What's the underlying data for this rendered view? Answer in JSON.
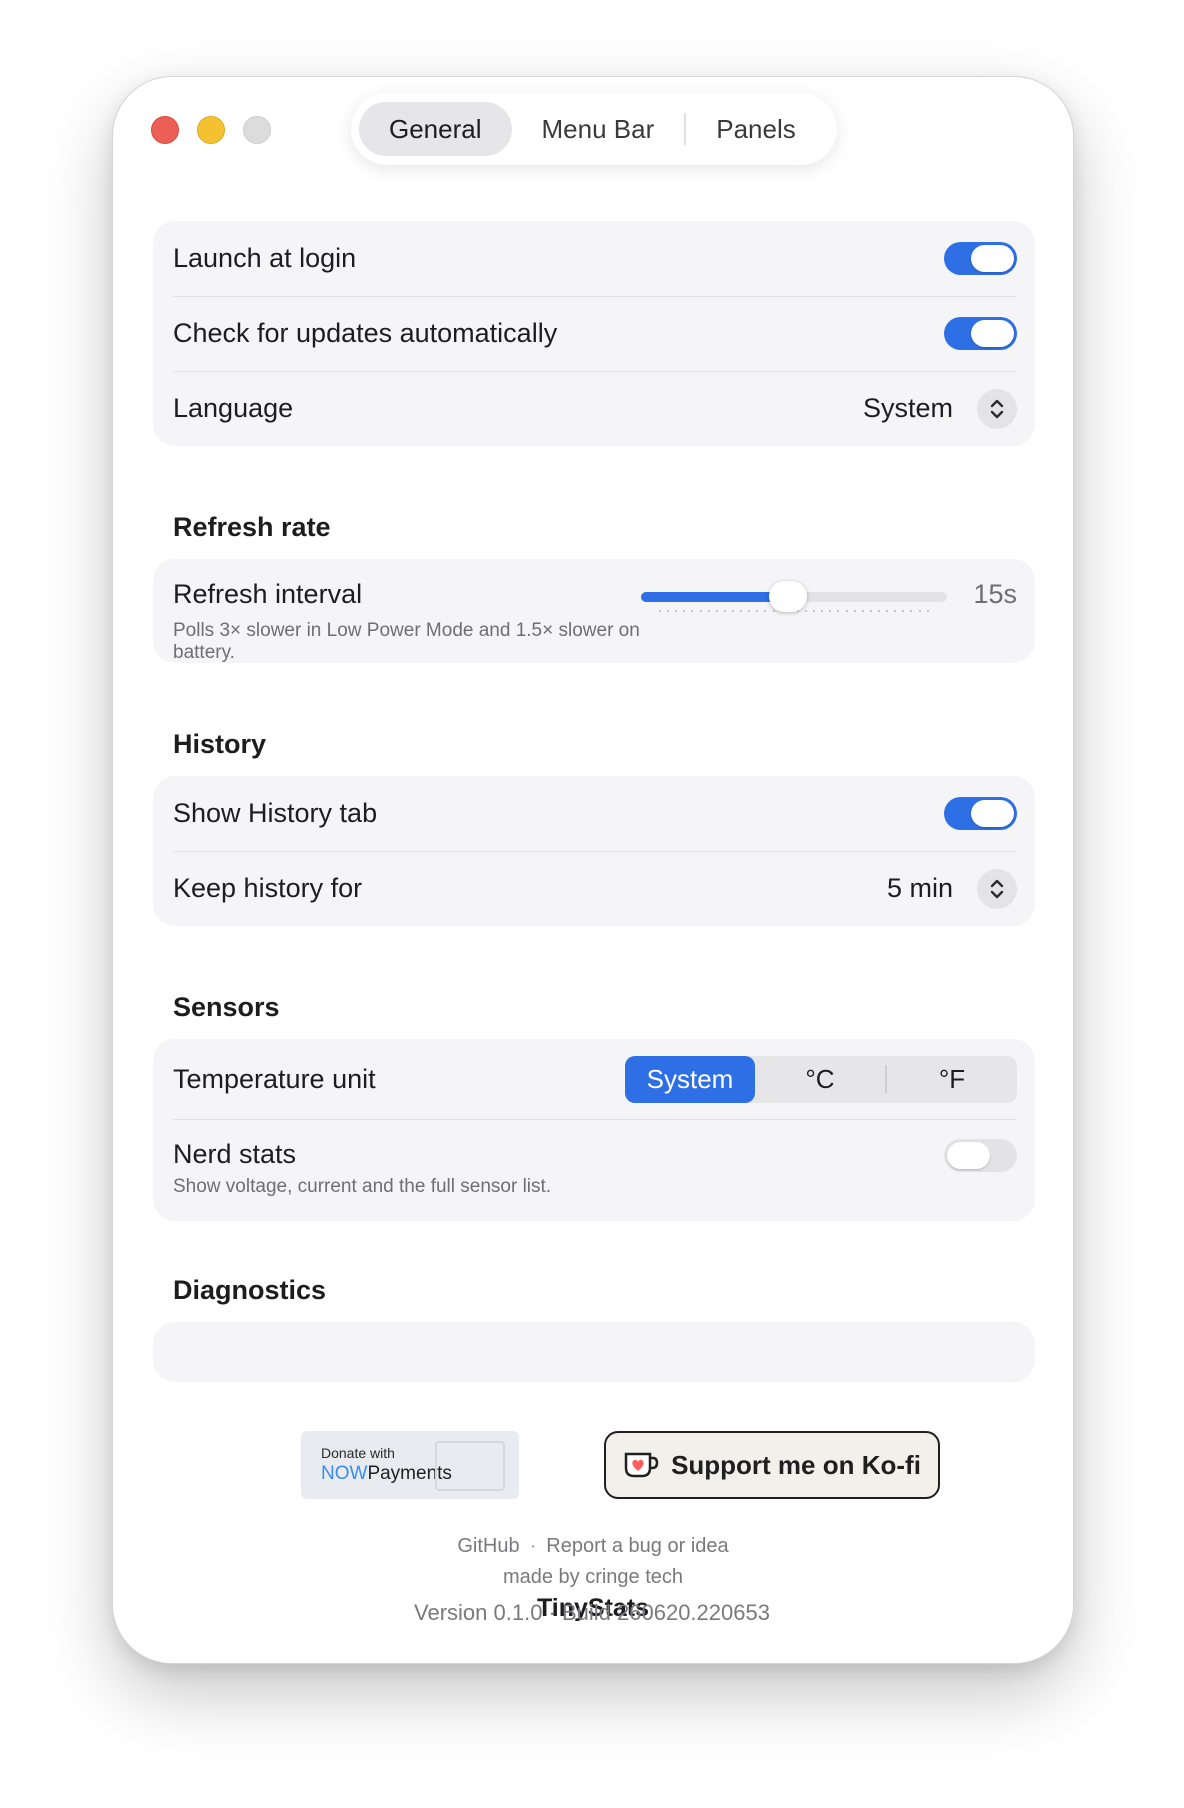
{
  "window": {
    "tabs": [
      {
        "label": "General",
        "active": true
      },
      {
        "label": "Menu Bar",
        "active": false
      },
      {
        "label": "Panels",
        "active": false
      }
    ]
  },
  "general": {
    "launch_at_login": {
      "label": "Launch at login",
      "on": true
    },
    "check_updates": {
      "label": "Check for updates automatically",
      "on": true
    },
    "language": {
      "label": "Language",
      "value": "System"
    }
  },
  "refresh": {
    "title": "Refresh rate",
    "interval_label": "Refresh interval",
    "interval_value": "15s",
    "interval_fraction": 0.48,
    "note": "Polls 3× slower in Low Power Mode and 1.5× slower on battery."
  },
  "history": {
    "title": "History",
    "show_tab": {
      "label": "Show History tab",
      "on": true
    },
    "keep_for": {
      "label": "Keep history for",
      "value": "5 min"
    }
  },
  "sensors": {
    "title": "Sensors",
    "temperature_unit": {
      "label": "Temperature unit",
      "options": [
        "System",
        "°C",
        "°F"
      ],
      "selected": "System"
    },
    "nerd_stats": {
      "label": "Nerd stats",
      "note": "Show voltage, current and the full sensor list.",
      "on": false
    }
  },
  "diagnostics": {
    "title": "Diagnostics"
  },
  "footer": {
    "nowpayments": {
      "line1": "Donate with",
      "brand_now": "NOW",
      "brand_rest": "Payments"
    },
    "kofi_label": "Support me on Ko-fi",
    "github_link": "GitHub",
    "separator": "·",
    "report_link": "Report a bug or idea",
    "made_by": "made by cringe tech",
    "app_name": "TinyStats"
  },
  "version_text": "Version 0.1.0 · Build 260620.220653",
  "colors": {
    "accent": "#2e6fe6",
    "card": "#f5f5f7",
    "close": "#ec5f57",
    "minimize": "#f4c131",
    "kofi_heart": "#ff5e5b"
  },
  "icons": [
    "close-light",
    "minimize-light",
    "zoom-light",
    "chevron-up-down-icon",
    "kofi-cup-icon"
  ]
}
